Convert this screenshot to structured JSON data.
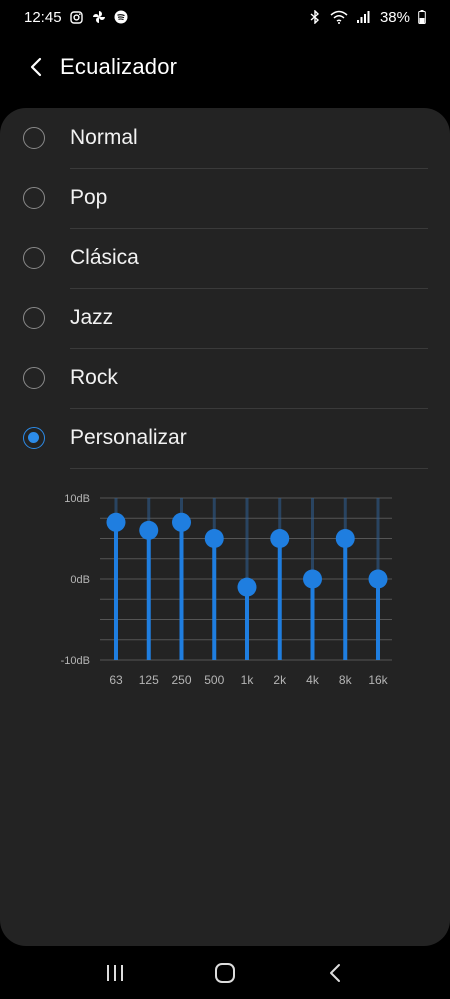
{
  "status": {
    "time": "12:45",
    "battery": "38%"
  },
  "header": {
    "title": "Ecualizador"
  },
  "options": [
    {
      "label": "Normal",
      "selected": false
    },
    {
      "label": "Pop",
      "selected": false
    },
    {
      "label": "Clásica",
      "selected": false
    },
    {
      "label": "Jazz",
      "selected": false
    },
    {
      "label": "Rock",
      "selected": false
    },
    {
      "label": "Personalizar",
      "selected": true
    }
  ],
  "equalizer": {
    "y_labels": [
      "10dB",
      "0dB",
      "-10dB"
    ],
    "bands": [
      "63",
      "125",
      "250",
      "500",
      "1k",
      "2k",
      "4k",
      "8k",
      "16k"
    ],
    "values_db": [
      7,
      6,
      7,
      5,
      -1,
      5,
      0,
      5,
      0
    ],
    "range_db": [
      -10,
      10
    ]
  },
  "colors": {
    "accent": "#2c8be8",
    "slider": "#1f7ee0",
    "background": "#000000",
    "card": "#232323"
  }
}
